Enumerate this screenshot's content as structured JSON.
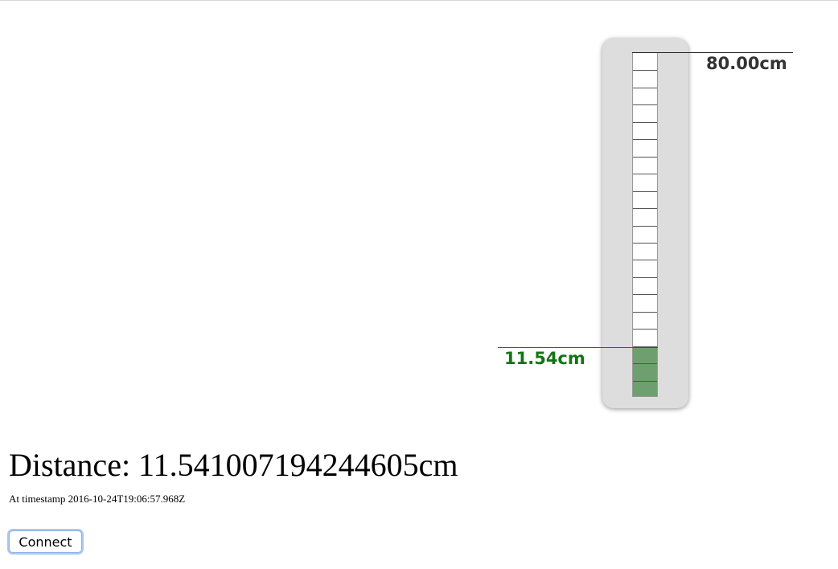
{
  "gauge": {
    "max_value": 80,
    "current_value": 11.541007194244605,
    "max_label": "80.00cm",
    "value_label": "11.54cm",
    "segments": 20,
    "fill_color": "#6e9f6e",
    "value_color": "#137513"
  },
  "readout": {
    "distance_text": "Distance: 11.541007194244605cm",
    "timestamp_text": "At timestamp 2016-10-24T19:06:57.968Z"
  },
  "controls": {
    "connect_label": "Connect"
  }
}
